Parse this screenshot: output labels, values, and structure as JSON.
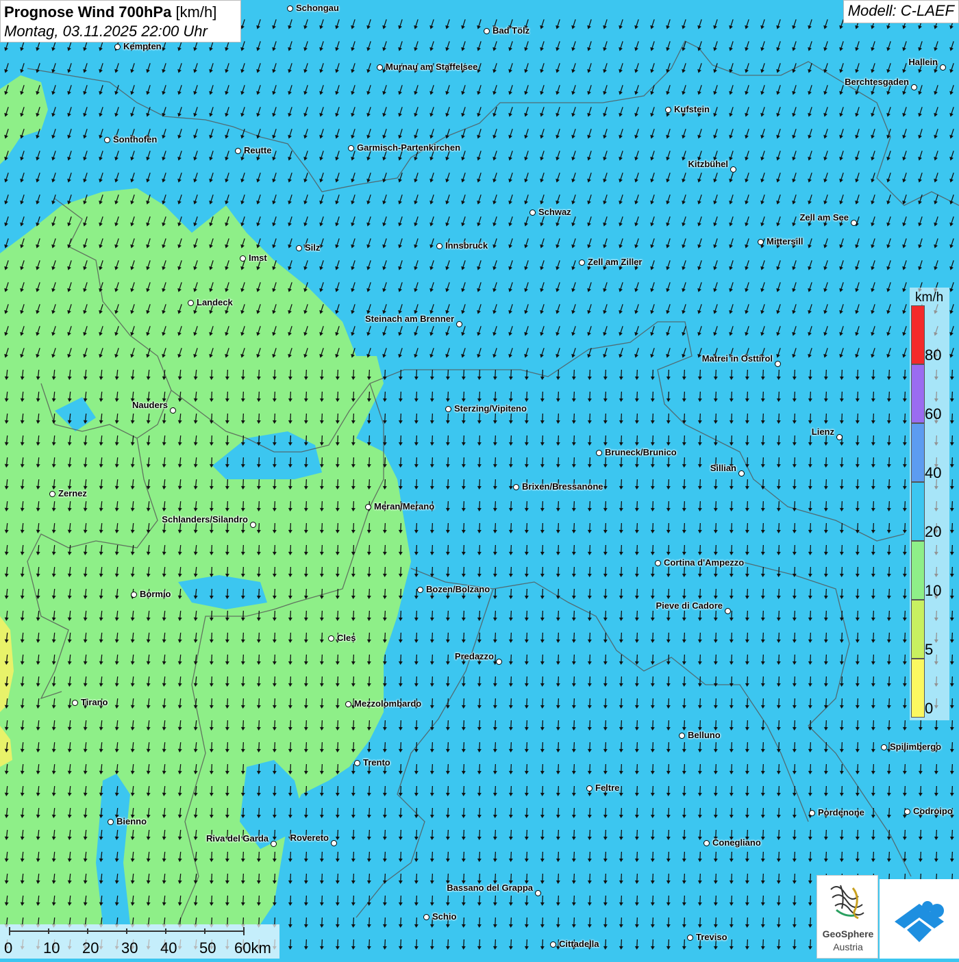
{
  "header": {
    "title_bold": "Prognose Wind 700hPa",
    "title_unit": "[km/h]",
    "datetime": "Montag, 03.11.2025 22:00 Uhr",
    "model": "Modell: C-LAEF"
  },
  "legend": {
    "unit": "km/h",
    "labels": [
      "80",
      "60",
      "40",
      "20",
      "10",
      "5",
      "0"
    ],
    "colors": [
      "#f42a2a",
      "#9a6cf0",
      "#5c9cf0",
      "#3cc6f0",
      "#8eef88",
      "#c8f060",
      "#fbf860"
    ]
  },
  "scale": {
    "labels": [
      "0",
      "10",
      "20",
      "30",
      "40",
      "50",
      "60km"
    ]
  },
  "logo": {
    "line1": "GeoSphere",
    "line2": "Austria"
  },
  "colors": {
    "sea_blue": "#3cc6f0",
    "light_green": "#8eef88",
    "yellow": "#e8f26a"
  },
  "wind_direction": "north-to-south",
  "cities": [
    {
      "name": "Schongau"
    },
    {
      "name": "Bad Tölz"
    },
    {
      "name": "Kempten"
    },
    {
      "name": "Murnau am Staffelsee"
    },
    {
      "name": "Hallein"
    },
    {
      "name": "Berchtesgaden"
    },
    {
      "name": "Kufstein"
    },
    {
      "name": "Sonthofen"
    },
    {
      "name": "Reutte"
    },
    {
      "name": "Garmisch-Partenkirchen"
    },
    {
      "name": "Kitzbühel"
    },
    {
      "name": "Schwaz"
    },
    {
      "name": "Zell am See"
    },
    {
      "name": "Innsbruck"
    },
    {
      "name": "Mittersill"
    },
    {
      "name": "Silz"
    },
    {
      "name": "Imst"
    },
    {
      "name": "Zell am Ziller"
    },
    {
      "name": "Landeck"
    },
    {
      "name": "Steinach am Brenner"
    },
    {
      "name": "Matrei in Osttirol"
    },
    {
      "name": "Nauders"
    },
    {
      "name": "Sterzing/Vipiteno"
    },
    {
      "name": "Lienz"
    },
    {
      "name": "Bruneck/Brunico"
    },
    {
      "name": "Sillian"
    },
    {
      "name": "Brixen/Bressanone"
    },
    {
      "name": "Zernez"
    },
    {
      "name": "Meran/Merano"
    },
    {
      "name": "Schlanders/Silandro"
    },
    {
      "name": "Cortina d'Ampezzo"
    },
    {
      "name": "Bozen/Bolzano"
    },
    {
      "name": "Bormio"
    },
    {
      "name": "Pieve di Cadore"
    },
    {
      "name": "Cles"
    },
    {
      "name": "Predazzo"
    },
    {
      "name": "Tirano"
    },
    {
      "name": "Mezzolombardo"
    },
    {
      "name": "Belluno"
    },
    {
      "name": "Spilimbergo"
    },
    {
      "name": "Trento"
    },
    {
      "name": "Feltre"
    },
    {
      "name": "Pordenone"
    },
    {
      "name": "Codroipo"
    },
    {
      "name": "Bienno"
    },
    {
      "name": "Riva del Garda"
    },
    {
      "name": "Rovereto"
    },
    {
      "name": "Conegliano"
    },
    {
      "name": "Bassano del Grappa"
    },
    {
      "name": "Schio"
    },
    {
      "name": "Treviso"
    },
    {
      "name": "Cittadella"
    }
  ]
}
